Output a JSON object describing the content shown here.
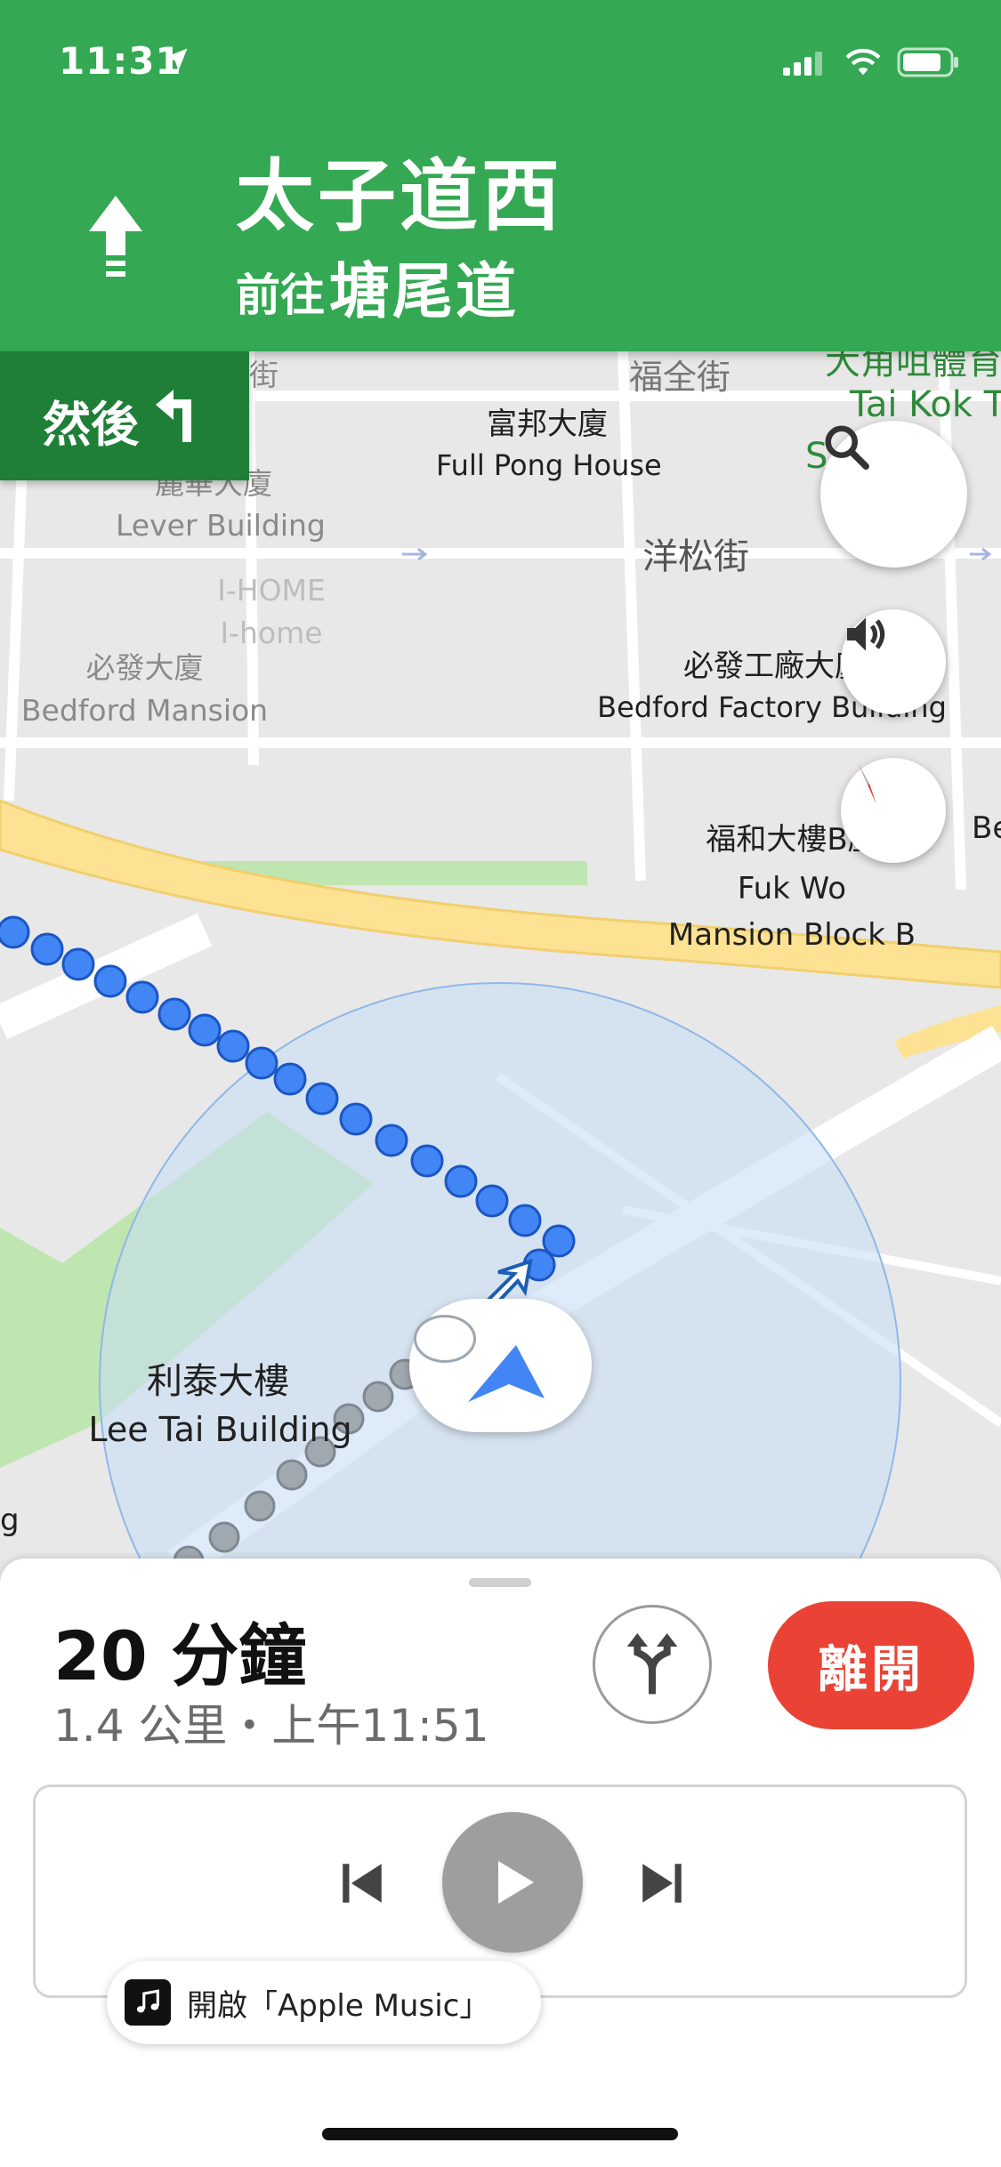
{
  "status_bar": {
    "time": "11:31"
  },
  "navigation": {
    "direction_icon": "straight-arrow-icon",
    "street": "太子道西",
    "toward_prefix": "前往",
    "toward_street": "塘尾道",
    "then_label": "然後"
  },
  "map": {
    "labels": {
      "fuk_chuen_st": "福全街",
      "big_street_partial": "街",
      "full_pong_zh": "富邦大廈",
      "full_pong_en": "Full Pong House",
      "lever_zh": "麗華大廈",
      "lever_en": "Lever Building",
      "ihome_1": "I-HOME",
      "ihome_2": "I-home",
      "yeung_chung_st": "洋松街",
      "bedford_zh": "必發大廈",
      "bedford_en": "Bedford Mansion",
      "bedford_factory_zh": "必發工廠大廈",
      "bedford_factory_en": "Bedford Factory Building",
      "fuk_wo_zh": "福和大樓B座",
      "fuk_wo_en_1": "Fuk Wo",
      "fuk_wo_en_2": "Mansion Block B",
      "tai_kok_tsui_zh": "大角咀體育",
      "tai_kok_tsui_en_1": "Tai Kok T",
      "tai_kok_tsui_en_2": "S        Cen",
      "be_partial": "Be",
      "lee_tai_zh": "利泰大樓",
      "lee_tai_en": "Lee Tai Building",
      "g_partial": "g"
    },
    "controls": {
      "search_icon": "search-icon",
      "sound_icon": "volume-icon",
      "compass_icon": "compass-icon"
    }
  },
  "trip": {
    "duration": "20 分鐘",
    "detail": "1.4 公里・上午11:51",
    "exit_label": "離開",
    "alt_routes_icon": "alternate-routes-icon"
  },
  "media": {
    "open_app_label": "開啟「Apple Music」",
    "prev_icon": "skip-previous-icon",
    "play_icon": "play-icon",
    "next_icon": "skip-next-icon"
  },
  "colors": {
    "banner_green": "#34a853",
    "then_green": "#1f7f37",
    "route_blue": "#4285f4",
    "exit_red": "#ea4335",
    "highway_yellow": "#fde293"
  }
}
